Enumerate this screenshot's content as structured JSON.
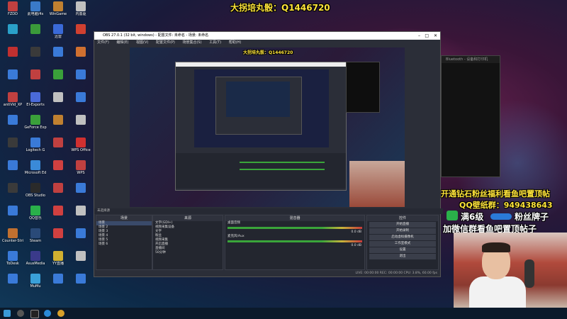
{
  "overlay": {
    "top_banner": "大拐培丸骰：Q1446720",
    "promo_line": "开通钻石粉丝福利看鱼吧置顶帖",
    "qq_group": "QQ壁纸群：949438643",
    "fan_badge": "满6级",
    "fan_badge_tail": "粉丝牌子",
    "join_line": "加微信群看鱼吧置顶帖子"
  },
  "desktop_icons": [
    {
      "label": "FZDD",
      "color": "#c04040"
    },
    {
      "label": "此电脑/4s",
      "color": "#3a7ac8"
    },
    {
      "label": "WinGame",
      "color": "#c08030"
    },
    {
      "label": "内置驱",
      "color": "#c0c0c0"
    },
    {
      "label": "",
      "color": "#2aa0c8"
    },
    {
      "label": "",
      "color": "#3a9a3a"
    },
    {
      "label": "迅雷",
      "color": "#3a6ad8"
    },
    {
      "label": "",
      "color": "#d04030"
    },
    {
      "label": "",
      "color": "#c03030"
    },
    {
      "label": "",
      "color": "#3a3a3a"
    },
    {
      "label": "",
      "color": "#3a7ad8"
    },
    {
      "label": "",
      "color": "#d07030"
    },
    {
      "label": "",
      "color": "#3a7ad8"
    },
    {
      "label": "",
      "color": "#c04040"
    },
    {
      "label": "",
      "color": "#3aa03a"
    },
    {
      "label": "",
      "color": "#3a7ad8"
    },
    {
      "label": "antiVid_XP",
      "color": "#c04040"
    },
    {
      "label": "EI-Exports",
      "color": "#4a6ad8"
    },
    {
      "label": "",
      "color": "#c0c0c0"
    },
    {
      "label": "",
      "color": "#3a7ad8"
    },
    {
      "label": "",
      "color": "#3a7ad8"
    },
    {
      "label": "GeForce Exp",
      "color": "#3aa03a"
    },
    {
      "label": "",
      "color": "#c08030"
    },
    {
      "label": "",
      "color": "#c0c0c0"
    },
    {
      "label": "",
      "color": "#3a3a3a"
    },
    {
      "label": "Logitech G",
      "color": "#3a7ad8"
    },
    {
      "label": "",
      "color": "#c04040"
    },
    {
      "label": "WPS Office",
      "color": "#d03030"
    },
    {
      "label": "",
      "color": "#3a7ad8"
    },
    {
      "label": "Microsoft Ed",
      "color": "#3a8ad8"
    },
    {
      "label": "",
      "color": "#d04040"
    },
    {
      "label": "WPS",
      "color": "#c04040"
    },
    {
      "label": "",
      "color": "#3a3a3a"
    },
    {
      "label": "OBS Studio",
      "color": "#2a2a2a"
    },
    {
      "label": "",
      "color": "#c04040"
    },
    {
      "label": "",
      "color": "#3a7ad8"
    },
    {
      "label": "",
      "color": "#3a7ad8"
    },
    {
      "label": "QQ音乐",
      "color": "#2ab04a"
    },
    {
      "label": "",
      "color": "#d04040"
    },
    {
      "label": "",
      "color": "#c0c0c0"
    },
    {
      "label": "Counter-Stri",
      "color": "#c07030"
    },
    {
      "label": "Steam",
      "color": "#2a4a78"
    },
    {
      "label": "",
      "color": "#d04040"
    },
    {
      "label": "",
      "color": "#3a7ad8"
    },
    {
      "label": "ToDesk",
      "color": "#3a7ad8"
    },
    {
      "label": "AsusMedia",
      "color": "#3a3a8a"
    },
    {
      "label": "YY直播",
      "color": "#d0b030"
    },
    {
      "label": "",
      "color": "#c0c0c0"
    },
    {
      "label": "",
      "color": "#3a7ad8"
    },
    {
      "label": "MuMu",
      "color": "#3aa0d8"
    },
    {
      "label": "",
      "color": "#3a7ad8"
    },
    {
      "label": "",
      "color": "#3a7ad8"
    }
  ],
  "obs": {
    "title": "OBS 27.0.1 (32 bit, windows) - 配置文件: 未命名 - 场景: 未命名",
    "menu": [
      "文件(F)",
      "编辑(E)",
      "视图(V)",
      "配置文件(P)",
      "场景集合(S)",
      "工具(T)",
      "帮助(H)"
    ],
    "status_line": "未选择源",
    "docks": {
      "scenes": {
        "title": "场景",
        "items": [
          "场景",
          "场景 2",
          "场景 3",
          "场景 4",
          "场景 5",
          "场景 6"
        ]
      },
      "sources": {
        "title": "来源",
        "items": [
          "文字(GDI+)",
          "视频采集设备",
          "文字",
          "粉丝",
          "视频采集",
          "开启直播",
          "直播间",
          "50分钟"
        ]
      },
      "mixer": {
        "title": "混音器",
        "channels": [
          "桌面音频",
          "麦克风/Aux"
        ],
        "levels": [
          "0.0 dB",
          "0.0 dB"
        ]
      },
      "controls": {
        "title": "控件",
        "buttons": [
          "开始直播",
          "开始录制",
          "启动虚拟摄像机",
          "工作室模式",
          "设置",
          "退出"
        ]
      }
    },
    "bottom_status": "LIVE: 00:00:00   REC: 00:00:00   CPU: 3.8%, 60.00 fps"
  },
  "side_window_title": "Bluetooth - 设备和打印机",
  "taskbar": {
    "icons": [
      "start",
      "search",
      "obs",
      "edge",
      "chrome",
      "explorer",
      "steam",
      "qq"
    ]
  }
}
